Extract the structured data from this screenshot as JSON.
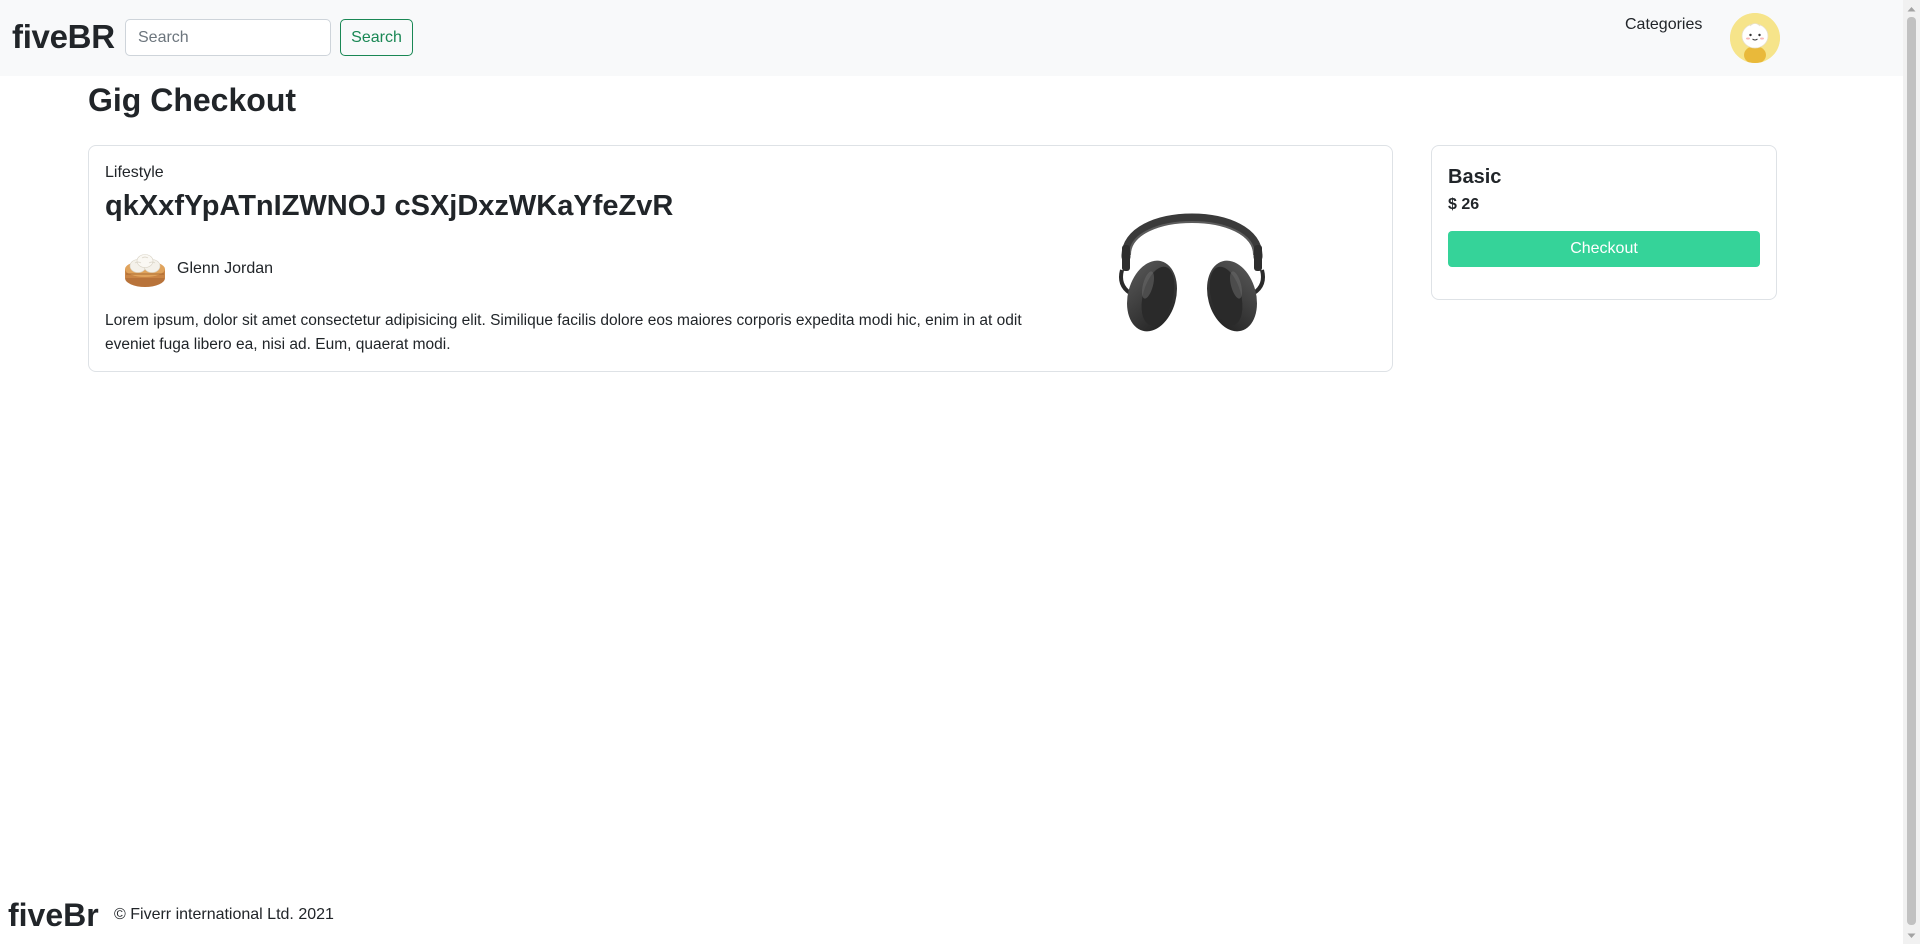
{
  "header": {
    "brand": "fiveBR",
    "search": {
      "placeholder": "Search",
      "value": "",
      "button_label": "Search"
    },
    "nav": {
      "categories_label": "Categories"
    },
    "avatar_icon": "user-avatar-icon"
  },
  "main": {
    "title": "Gig Checkout",
    "gig": {
      "category": "Lifestyle",
      "title": "qkXxfYpATnIZWNOJ cSXjDxzWKaYfeZvR",
      "seller_name": "Glenn Jordan",
      "seller_avatar_icon": "dumplings-icon",
      "description": "Lorem ipsum, dolor sit amet consectetur adipisicing elit. Similique facilis dolore eos maiores corporis expedita modi hic, enim in at odit eveniet fuga libero ea, nisi ad. Eum, quaerat modi.",
      "image_icon": "headphones-icon"
    },
    "package": {
      "name": "Basic",
      "price": "$ 26",
      "checkout_label": "Checkout"
    }
  },
  "footer": {
    "brand": "fiveBr",
    "copyright": "© Fiverr international Ltd. 2021"
  },
  "colors": {
    "navbar_bg": "#f8f9fa",
    "success_outline": "#198754",
    "checkout_bg": "#35d399",
    "card_border": "#dee2e6"
  }
}
